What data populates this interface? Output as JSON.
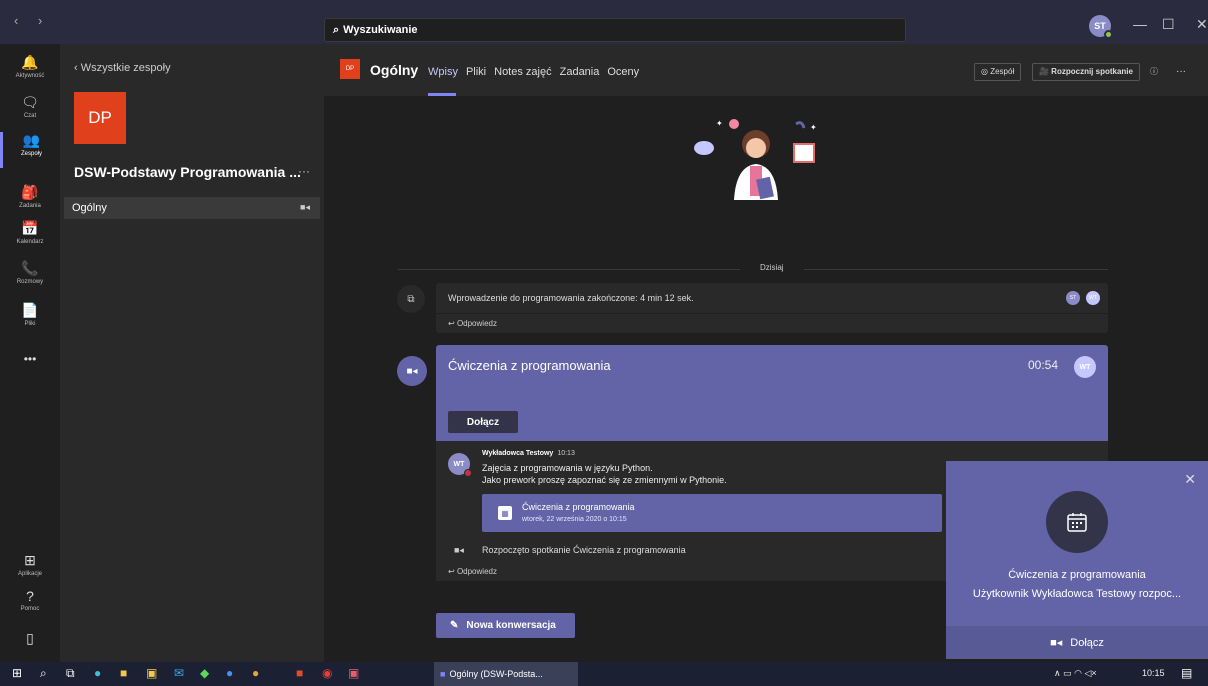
{
  "window": {
    "search_placeholder": "Wyszukiwanie",
    "user_initials": "ST",
    "minimize": "—",
    "maximize": "☐",
    "close": "✕",
    "nav_back": "‹",
    "nav_forward": "›"
  },
  "rail": {
    "items": [
      {
        "label": "Aktywność",
        "icon": "bell-icon",
        "glyph": "🔔"
      },
      {
        "label": "Czat",
        "icon": "chat-icon",
        "glyph": "🗨"
      },
      {
        "label": "Zespoły",
        "icon": "teams-icon",
        "glyph": "👥"
      },
      {
        "label": "Zadania",
        "icon": "assignments-icon",
        "glyph": "🎒"
      },
      {
        "label": "Kalendarz",
        "icon": "calendar-icon",
        "glyph": "📅"
      },
      {
        "label": "Rozmowy",
        "icon": "phone-icon",
        "glyph": "📞"
      },
      {
        "label": "Pliki",
        "icon": "files-icon",
        "glyph": "📄"
      }
    ],
    "more": "•••",
    "apps_label": "Aplikacje",
    "help_label": "Pomoc"
  },
  "panel": {
    "back_label": "Wszystkie zespoły",
    "team_initials": "DP",
    "team_name": "DSW-Podstawy Programowania ...",
    "more": "···",
    "channel": "Ogólny"
  },
  "header": {
    "channel_initials": "DP",
    "channel_name": "Ogólny",
    "tabs": [
      "Wpisy",
      "Pliki",
      "Notes zajęć",
      "Zadania",
      "Oceny"
    ],
    "team_btn": "◎ Zespół",
    "meet_btn": "🎥 Rozpocznij spotkanie",
    "more": "···"
  },
  "feed": {
    "today": "Dzisiaj",
    "post1_title": "Wprowadzenie do programowania zakończone: 4 min 12 sek.",
    "reply": "Odpowiedz",
    "avatars": [
      "ST",
      "WT"
    ],
    "meeting_title": "Ćwiczenia z programowania",
    "meeting_duration": "00:54",
    "meeting_avatar": "WT",
    "join": "Dołącz",
    "author": "Wykładowca Testowy",
    "author_time": "10:13",
    "author_initials": "WT",
    "msg_line1": "Zajęcia z programowania w języku Python.",
    "msg_line2": "Jako prework proszę zapoznać się ze zmiennymi w Pythonie.",
    "card_title": "Ćwiczenia z programowania",
    "card_date": "wtorek, 22 września 2020 o 10:15",
    "started": "Rozpoczęto spotkanie Ćwiczenia z programowania",
    "new_conversation": "Nowa konwersacja"
  },
  "toast": {
    "title": "Ćwiczenia z programowania",
    "message": "Użytkownik Wykładowca Testowy rozpoc...",
    "join": "Dołącz"
  },
  "taskbar": {
    "app_label": "Ogólny (DSW-Podsta...",
    "time": "10:15"
  },
  "colors": {
    "accent": "#6264a7",
    "accent_light": "#7f85f5",
    "team_logo": "#e1401d"
  }
}
